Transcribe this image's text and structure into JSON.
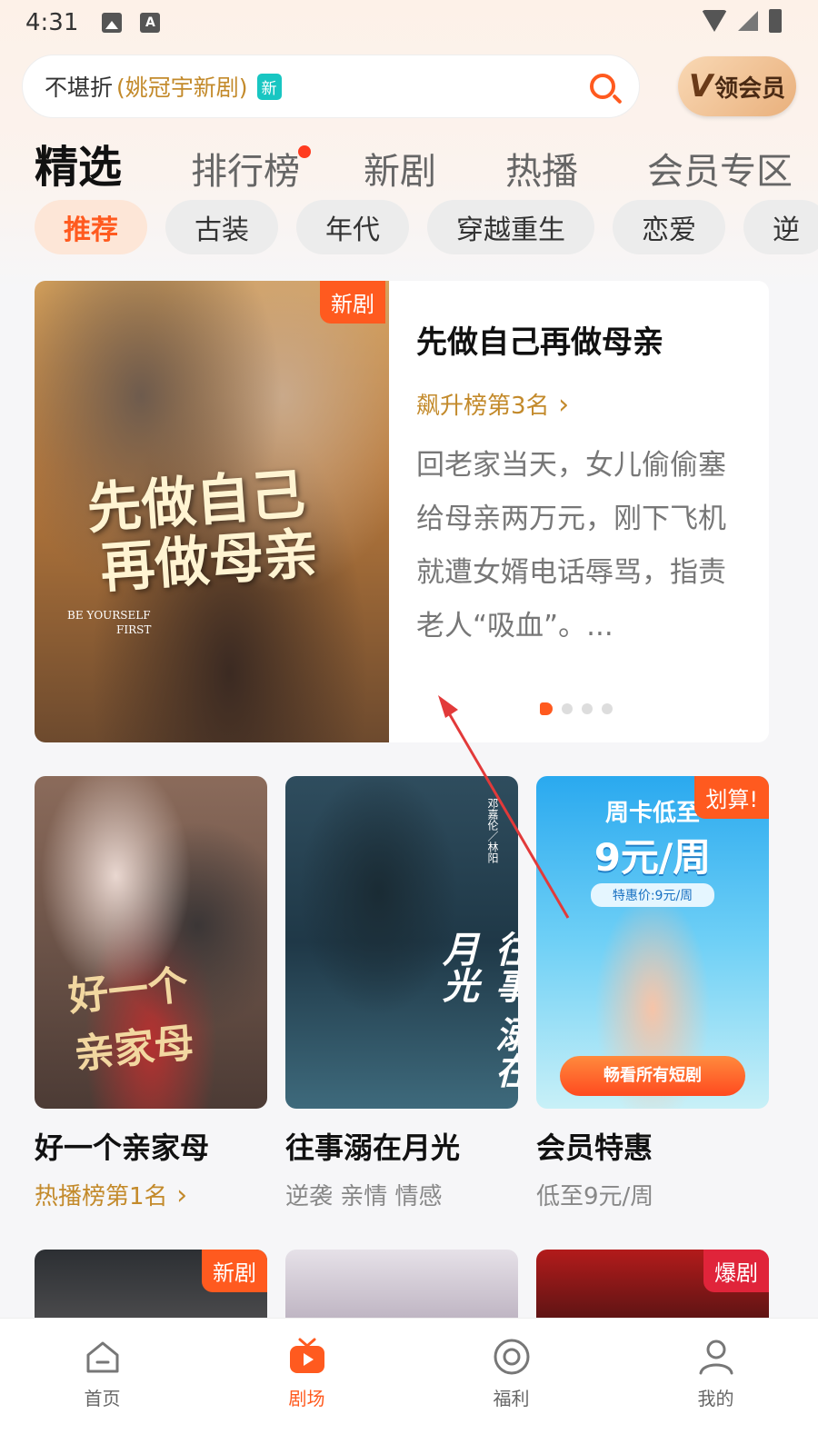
{
  "status_bar": {
    "time": "4:31",
    "icons": [
      "image-icon",
      "a-icon",
      "wifi-icon",
      "signal-icon",
      "battery-icon"
    ]
  },
  "search": {
    "text": "不堪折",
    "sub": "(姚冠宇新剧)",
    "tag": "新"
  },
  "vip_button": {
    "mark": "V",
    "label": "领会员"
  },
  "main_tabs": [
    "精选",
    "排行榜",
    "新剧",
    "热播",
    "会员专区"
  ],
  "chips": [
    "推荐",
    "古装",
    "年代",
    "穿越重生",
    "恋爱",
    "逆"
  ],
  "feature": {
    "badge": "新剧",
    "poster_title_line1": "先做自己",
    "poster_title_line2": "再做母亲",
    "poster_en_line1": "BE YOURSELF",
    "poster_en_line2": "FIRST",
    "title": "先做自己再做母亲",
    "rank": "飙升榜第3名",
    "description": "回老家当天，女儿偷偷塞给母亲两万元，刚下飞机就遭女婿电话辱骂，指责老人“吸血”。...",
    "carousel": {
      "count": 4,
      "active_index": 0
    }
  },
  "grid": [
    {
      "title": "好一个亲家母",
      "sub": "热播榜第1名",
      "poster_text_1": "好一个",
      "poster_text_2": "亲家母"
    },
    {
      "title": "往事溺在月光",
      "sub": "逆袭 亲情 情感",
      "poster_text_1": "往事",
      "poster_text_2": "溺在月光",
      "poster_side_text": "邓嘉伦／林阳"
    },
    {
      "title": "会员特惠",
      "sub": "低至9元/周",
      "badge": "划算!",
      "promo_line1": "周卡低至",
      "promo_line2": "9元/周",
      "promo_price": "特惠价:9元/周",
      "promo_button": "畅看所有短剧"
    }
  ],
  "row3_badges": [
    "新剧",
    "爆剧"
  ],
  "bottom_nav": [
    {
      "label": "首页",
      "icon": "home-icon"
    },
    {
      "label": "剧场",
      "icon": "tv-icon",
      "active": true
    },
    {
      "label": "福利",
      "icon": "coin-icon"
    },
    {
      "label": "我的",
      "icon": "profile-icon"
    }
  ],
  "colors": {
    "accent": "#ff5a1f",
    "gold": "#c38a2b",
    "vip_teal": "#18c6c2"
  }
}
